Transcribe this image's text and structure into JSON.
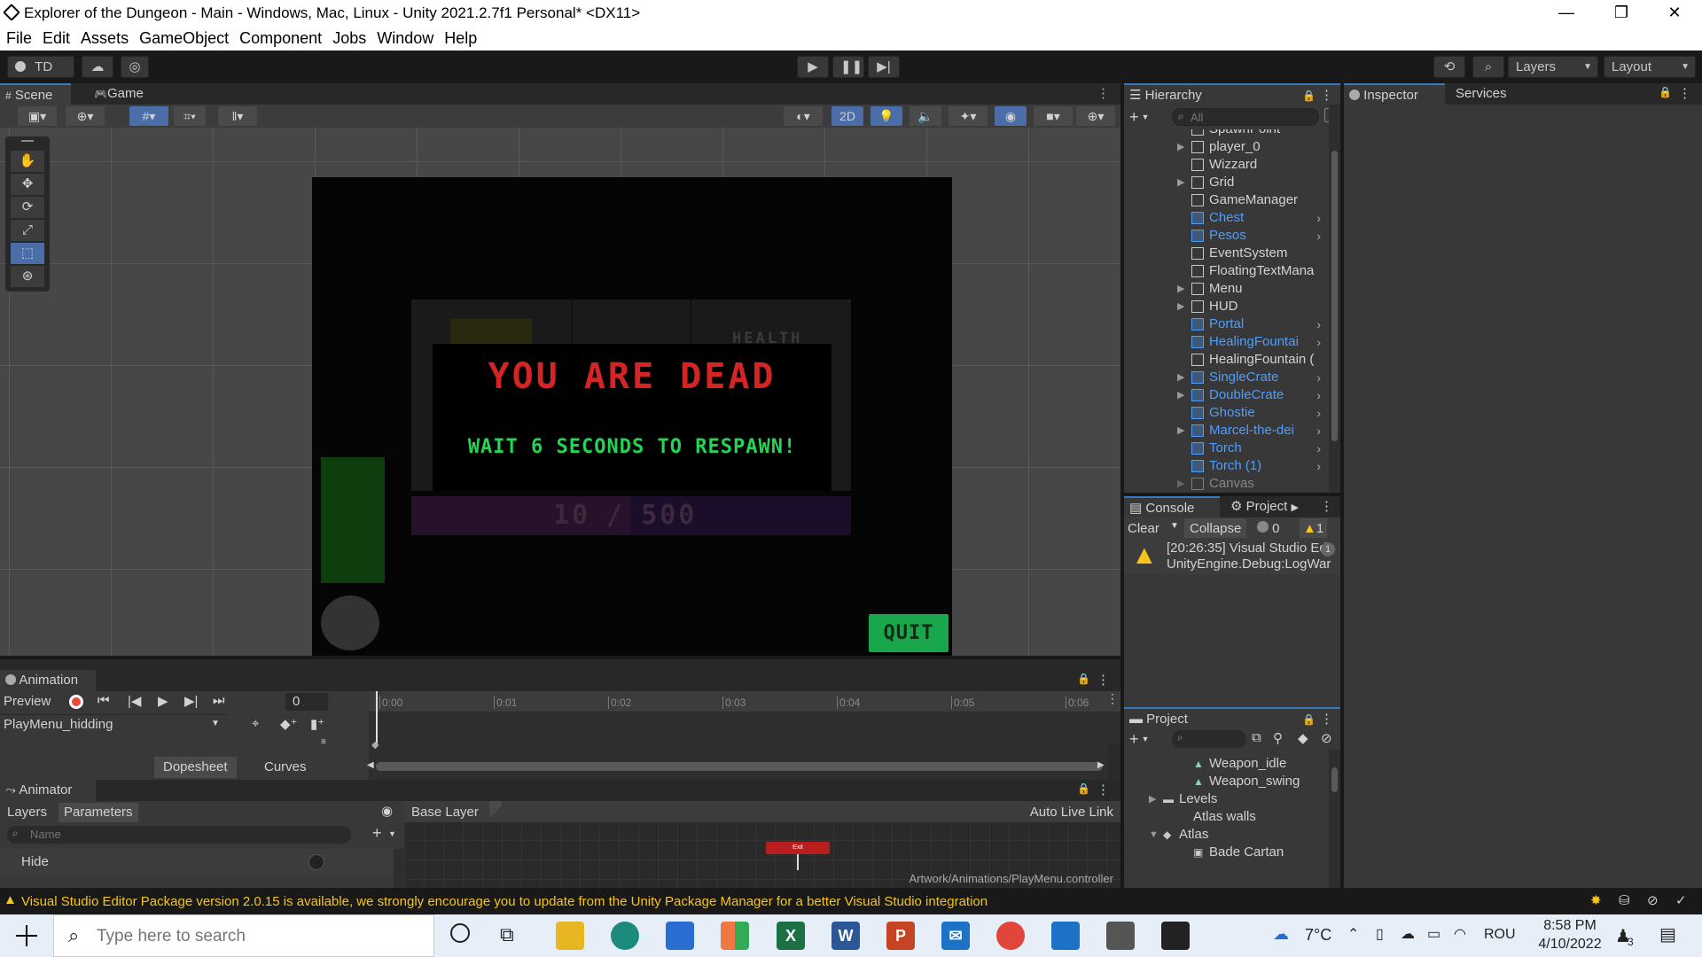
{
  "window": {
    "title": "Explorer of the Dungeon - Main - Windows, Mac, Linux - Unity 2021.2.7f1 Personal* <DX11>",
    "minimize": "—",
    "maximize": "❐",
    "close": "✕"
  },
  "menu": [
    "File",
    "Edit",
    "Assets",
    "GameObject",
    "Component",
    "Jobs",
    "Window",
    "Help"
  ],
  "toolbar": {
    "account": "TD",
    "layers": "Layers",
    "layout": "Layout"
  },
  "scene": {
    "tab_scene": "Scene",
    "tab_game": "Game",
    "mode_2d": "2D"
  },
  "game": {
    "health_label": "HEALTH",
    "dead_title": "YOU ARE DEAD",
    "respawn_text": "WAIT 6 SECONDS TO RESPAWN!",
    "xp_left": "10",
    "xp_sep": "/",
    "xp_right": "500",
    "quit_label": "QUIT"
  },
  "hierarchy": {
    "title": "Hierarchy",
    "search_placeholder": "All",
    "items": [
      {
        "label": "SpawnPoint",
        "expandable": false,
        "prefab": false
      },
      {
        "label": "player_0",
        "expandable": true,
        "prefab": false
      },
      {
        "label": "Wizzard",
        "expandable": false,
        "prefab": false
      },
      {
        "label": "Grid",
        "expandable": true,
        "prefab": false
      },
      {
        "label": "GameManager",
        "expandable": false,
        "prefab": false
      },
      {
        "label": "Chest",
        "expandable": false,
        "prefab": true
      },
      {
        "label": "Pesos",
        "expandable": false,
        "prefab": true
      },
      {
        "label": "EventSystem",
        "expandable": false,
        "prefab": false
      },
      {
        "label": "FloatingTextMana",
        "expandable": false,
        "prefab": false
      },
      {
        "label": "Menu",
        "expandable": true,
        "prefab": false
      },
      {
        "label": "HUD",
        "expandable": true,
        "prefab": false
      },
      {
        "label": "Portal",
        "expandable": false,
        "prefab": true
      },
      {
        "label": "HealingFountai",
        "expandable": false,
        "prefab": true
      },
      {
        "label": "HealingFountain (",
        "expandable": false,
        "prefab": false
      },
      {
        "label": "SingleCrate",
        "expandable": true,
        "prefab": true
      },
      {
        "label": "DoubleCrate",
        "expandable": true,
        "prefab": true
      },
      {
        "label": "Ghostie",
        "expandable": false,
        "prefab": true
      },
      {
        "label": "Marcel-the-dei",
        "expandable": true,
        "prefab": true
      },
      {
        "label": "Torch",
        "expandable": false,
        "prefab": true
      },
      {
        "label": "Torch (1)",
        "expandable": false,
        "prefab": true
      },
      {
        "label": "Canvas",
        "expandable": true,
        "prefab": false
      }
    ]
  },
  "inspector": {
    "tab_inspector": "Inspector",
    "tab_services": "Services"
  },
  "console": {
    "tab_console": "Console",
    "tab_project": "Project",
    "clear": "Clear",
    "collapse": "Collapse",
    "error_count": "0",
    "warning_count": "1",
    "entry_line1": "[20:26:35] Visual Studio Ed",
    "entry_line2": "UnityEngine.Debug:LogWar",
    "entry_count": "1"
  },
  "project": {
    "title": "Project",
    "items": [
      "Weapon_idle",
      "Weapon_swing",
      "Levels",
      "Atlas walls",
      "Atlas",
      "Bade Cartan"
    ]
  },
  "animation": {
    "title": "Animation",
    "preview": "Preview",
    "frame": "0",
    "clip": "PlayMenu_hidding",
    "ticks": [
      "0:00",
      "0:01",
      "0:02",
      "0:03",
      "0:04",
      "0:05",
      "0:06"
    ],
    "dopesheet": "Dopesheet",
    "curves": "Curves"
  },
  "animator": {
    "title": "Animator",
    "tab_layers": "Layers",
    "tab_parameters": "Parameters",
    "search_placeholder": "Name",
    "param_name": "Hide",
    "base_layer": "Base Layer",
    "auto_live_link": "Auto Live Link",
    "state_label": "Exit",
    "controller_path": "Artwork/Animations/PlayMenu.controller"
  },
  "status_bar": {
    "message": "Visual Studio Editor Package version 2.0.15 is available, we strongly encourage you to update from the Unity Package Manager for a better Visual Studio integration"
  },
  "taskbar": {
    "search_placeholder": "Type here to search",
    "temperature": "7°C",
    "language": "ROU",
    "time": "8:58 PM",
    "date": "4/10/2022",
    "notif_count": "3"
  }
}
